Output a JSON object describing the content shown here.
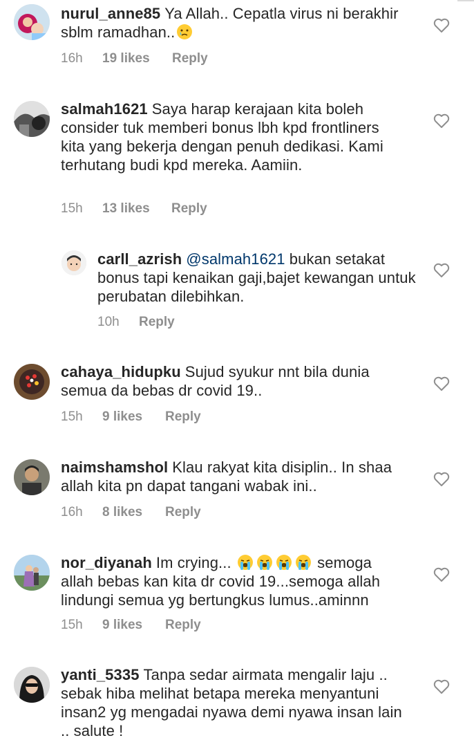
{
  "comments": [
    {
      "username": "nurul_anne85",
      "text": "Ya Allah.. Cepatla virus ni berakhir sblm ramadhan..",
      "emoji": [
        "crying-face"
      ],
      "time": "16h",
      "likes": "19 likes",
      "reply": "Reply"
    },
    {
      "username": "salmah1621",
      "text": "Saya harap kerajaan kita boleh consider tuk memberi bonus lbh kpd frontliners kita yang bekerja dengan penuh dedikasi. Kami terhutang budi kpd mereka. Aamiin.",
      "time": "15h",
      "likes": "13 likes",
      "reply": "Reply"
    },
    {
      "username": "carll_azrish",
      "mention": "@salmah1621",
      "text": "bukan setakat bonus tapi kenaikan gaji,bajet kewangan untuk perubatan dilebihkan.",
      "time": "10h",
      "reply": "Reply"
    },
    {
      "username": "cahaya_hidupku",
      "text": "Sujud syukur nnt bila dunia semua da bebas dr covid 19..",
      "time": "15h",
      "likes": "9 likes",
      "reply": "Reply"
    },
    {
      "username": "naimshamshol",
      "text": "Klau rakyat kita disiplin.. In shaa allah kita pn dapat tangani wabak ini..",
      "time": "16h",
      "likes": "8 likes",
      "reply": "Reply"
    },
    {
      "username": "nor_diyanah",
      "text_before": "Im crying...",
      "emoji": [
        "loudly-crying-face",
        "loudly-crying-face",
        "loudly-crying-face",
        "loudly-crying-face"
      ],
      "text_after": "semoga allah bebas kan kita dr covid 19...semoga allah lindungi semua yg bertungkus lumus..aminnn",
      "time": "15h",
      "likes": "9 likes",
      "reply": "Reply"
    },
    {
      "username": "yanti_5335",
      "text": "Tanpa sedar airmata mengalir laju .. sebak hiba melihat betapa mereka menyantuni insan2 yg mengadai nyawa demi nyawa insan lain .. salute !"
    }
  ],
  "colors": {
    "text": "#262626",
    "secondary": "#8e8e8e",
    "mention": "#00376b",
    "heart": "#8e8e8e"
  },
  "icons": {
    "like": "heart-outline-icon"
  }
}
